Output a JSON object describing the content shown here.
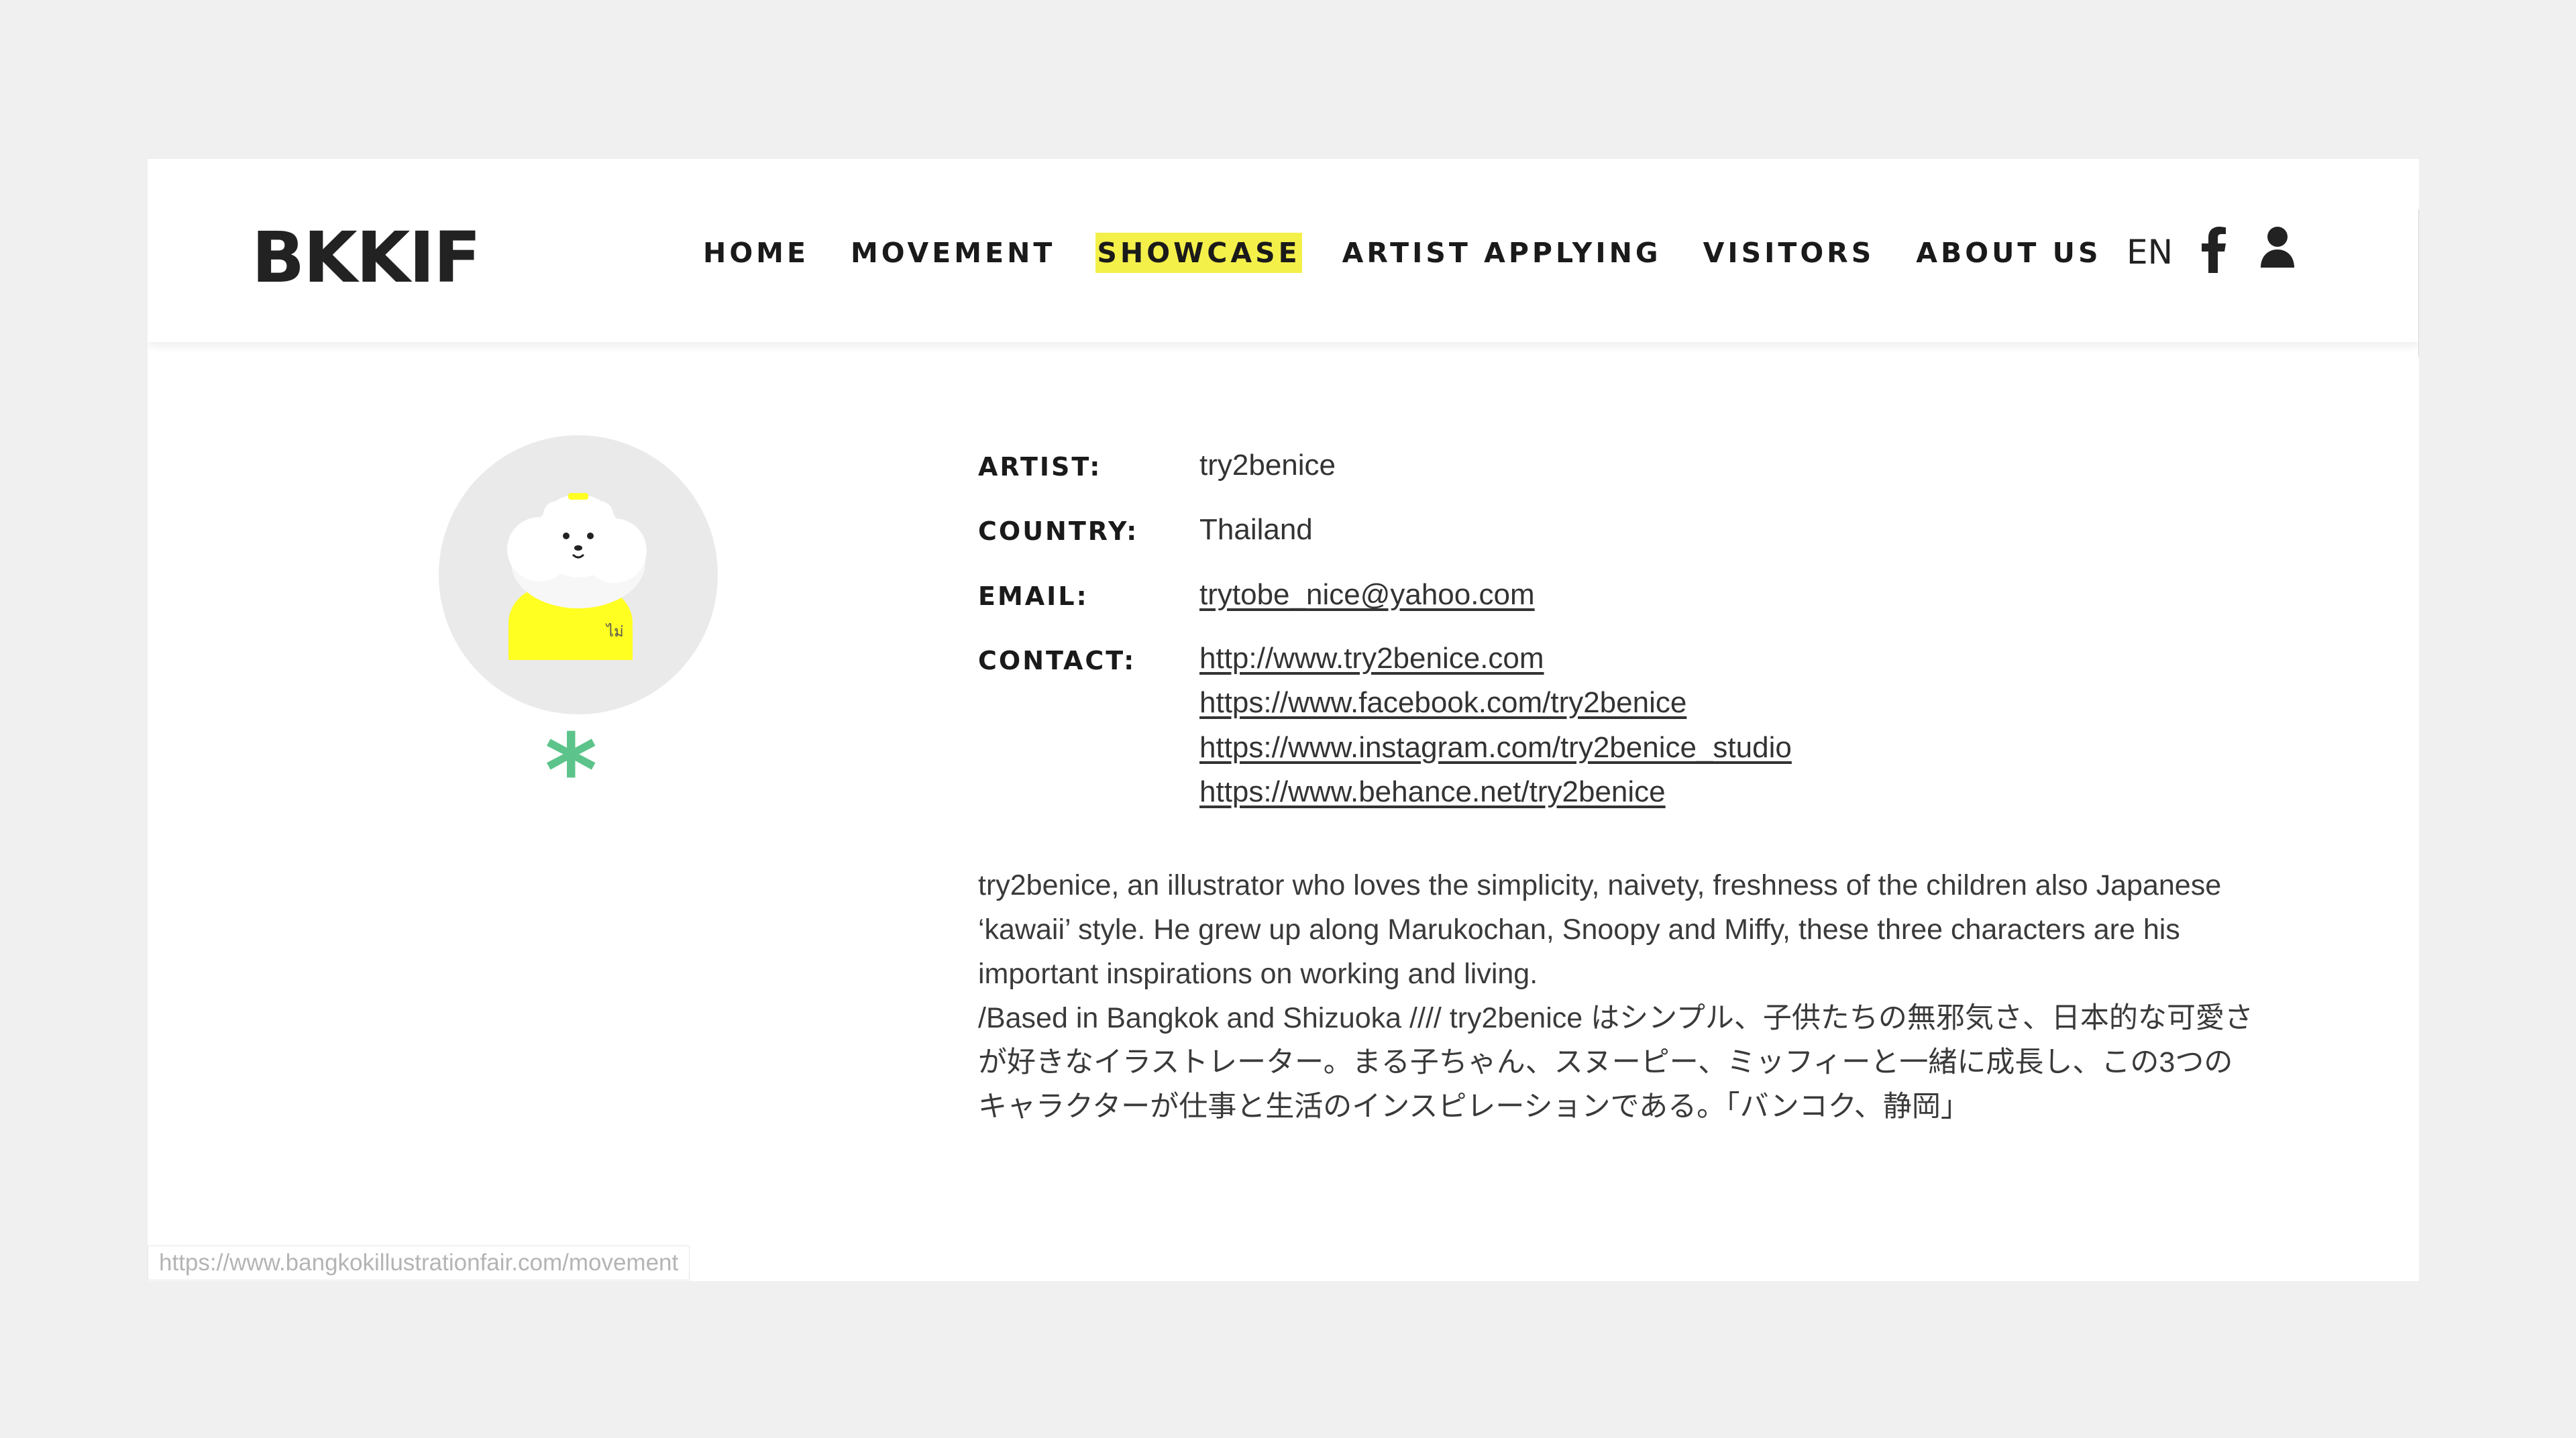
{
  "header": {
    "logo": "BKKIF",
    "nav": [
      {
        "label": "HOME"
      },
      {
        "label": "MOVEMENT"
      },
      {
        "label": "SHOWCASE",
        "active": true
      },
      {
        "label": "ARTIST APPLYING"
      },
      {
        "label": "VISITORS"
      },
      {
        "label": "ABOUT US"
      }
    ],
    "lang": "EN",
    "icons": [
      "facebook-icon",
      "user-icon"
    ]
  },
  "profile": {
    "artist_label": "ARTIST:",
    "artist_value": "try2benice",
    "country_label": "COUNTRY:",
    "country_value": "Thailand",
    "email_label": "EMAIL:",
    "email_value": "trytobe_nice@yahoo.com",
    "contact_label": "CONTACT:",
    "contacts": [
      "http://www.try2benice.com",
      "https://www.facebook.com/try2benice",
      "https://www.instagram.com/try2benice_studio",
      "https://www.behance.net/try2benice"
    ],
    "avatar_badge": "ไม่",
    "accent_color": "#5cc48a",
    "highlight_color": "#f4f04a"
  },
  "bio": {
    "lines": [
      "try2benice, an illustrator who loves the simplicity, naivety, freshness of the children also Japanese",
      "‘kawaii’ style. He grew up along Marukochan, Snoopy and Miffy, these three characters are his",
      "important inspirations on working and living.",
      "/Based in Bangkok and Shizuoka //// try2benice はシンプル、子供たちの無邪気さ、日本的な可愛さ",
      "が好きなイラストレーター。まる子ちゃん、スヌーピー、ミッフィーと一緒に成長し、この3つの",
      "キャラクターが仕事と生活のインスピレーションである。「バンコク、静岡」"
    ]
  },
  "status_bar": {
    "url": "https://www.bangkokillustrationfair.com/movement"
  }
}
